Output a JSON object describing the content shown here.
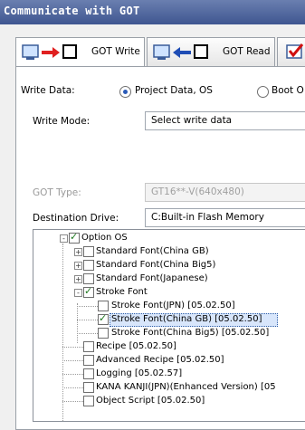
{
  "window": {
    "title": "Communicate with GOT"
  },
  "tabs": [
    {
      "label": "GOT Write"
    },
    {
      "label": "GOT Read"
    }
  ],
  "write_data": {
    "label": "Write Data:",
    "options": [
      {
        "label": "Project Data, OS",
        "selected": true
      },
      {
        "label": "Boot O",
        "selected": false
      }
    ]
  },
  "write_mode": {
    "label": "Write Mode:",
    "value": "Select write data"
  },
  "got_type": {
    "label": "GOT Type:",
    "value": "GT16**-V(640x480)"
  },
  "destination_drive": {
    "label": "Destination Drive:",
    "value": "C:Built-in Flash Memory"
  },
  "tree": [
    {
      "label": "Option OS",
      "checked": true,
      "expander": "-"
    },
    {
      "label": "Standard Font(China GB)",
      "checked": false,
      "expander": "+"
    },
    {
      "label": "Standard Font(China Big5)",
      "checked": false,
      "expander": "+"
    },
    {
      "label": "Standard Font(Japanese)",
      "checked": false,
      "expander": "+"
    },
    {
      "label": "Stroke Font",
      "checked": true,
      "expander": "-"
    },
    {
      "label": "Stroke Font(JPN) [05.02.50]",
      "checked": false
    },
    {
      "label": "Stroke Font(China GB) [05.02.50]",
      "checked": true,
      "selected": true
    },
    {
      "label": "Stroke Font(China Big5) [05.02.50]",
      "checked": false
    },
    {
      "label": "Recipe [05.02.50]",
      "checked": false
    },
    {
      "label": "Advanced Recipe [05.02.50]",
      "checked": false
    },
    {
      "label": "Logging [05.02.57]",
      "checked": false
    },
    {
      "label": "KANA KANJI(JPN)(Enhanced Version) [05",
      "checked": false
    },
    {
      "label": "Object Script [05.02.50]",
      "checked": false
    }
  ]
}
